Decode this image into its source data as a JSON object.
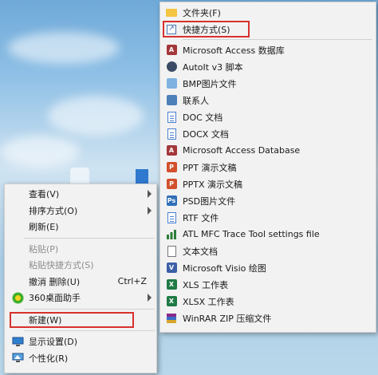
{
  "context_menu": {
    "items": [
      {
        "label": "查看(V)",
        "has_submenu": true,
        "disabled": false
      },
      {
        "label": "排序方式(O)",
        "has_submenu": true,
        "disabled": false
      },
      {
        "label": "刷新(E)",
        "has_submenu": false,
        "disabled": false
      },
      {
        "label": "粘贴(P)",
        "has_submenu": false,
        "disabled": true
      },
      {
        "label": "粘贴快捷方式(S)",
        "has_submenu": false,
        "disabled": true
      },
      {
        "label": "撤消 删除(U)",
        "shortcut": "Ctrl+Z",
        "has_submenu": false,
        "disabled": false
      },
      {
        "label": "360桌面助手",
        "icon": "360-assistant-icon",
        "has_submenu": true,
        "disabled": false
      },
      {
        "label": "新建(W)",
        "has_submenu": true,
        "disabled": false,
        "highlighted": true
      },
      {
        "label": "显示设置(D)",
        "icon": "display-settings-icon",
        "has_submenu": false,
        "disabled": false
      },
      {
        "label": "个性化(R)",
        "icon": "personalize-icon",
        "has_submenu": false,
        "disabled": false
      }
    ]
  },
  "new_submenu": {
    "items": [
      {
        "label": "文件夹(F)",
        "icon": "folder-icon"
      },
      {
        "label": "快捷方式(S)",
        "icon": "shortcut-icon",
        "highlighted": true
      },
      {
        "label": "Microsoft Access 数据库",
        "icon": "access-database-icon"
      },
      {
        "label": "AutoIt v3 脚本",
        "icon": "autoit-script-icon"
      },
      {
        "label": "BMP图片文件",
        "icon": "bmp-image-icon"
      },
      {
        "label": "联系人",
        "icon": "contact-icon"
      },
      {
        "label": "DOC 文档",
        "icon": "doc-document-icon"
      },
      {
        "label": "DOCX 文档",
        "icon": "docx-document-icon"
      },
      {
        "label": "Microsoft Access Database",
        "icon": "access-database-icon"
      },
      {
        "label": "PPT 演示文稿",
        "icon": "ppt-presentation-icon"
      },
      {
        "label": "PPTX 演示文稿",
        "icon": "pptx-presentation-icon"
      },
      {
        "label": "PSD图片文件",
        "icon": "psd-image-icon"
      },
      {
        "label": "RTF 文件",
        "icon": "rtf-file-icon"
      },
      {
        "label": "ATL MFC Trace Tool settings file",
        "icon": "atl-trace-settings-icon"
      },
      {
        "label": "文本文档",
        "icon": "text-document-icon"
      },
      {
        "label": "Microsoft Visio 绘图",
        "icon": "visio-drawing-icon"
      },
      {
        "label": "XLS 工作表",
        "icon": "xls-worksheet-icon"
      },
      {
        "label": "XLSX 工作表",
        "icon": "xlsx-worksheet-icon"
      },
      {
        "label": "WinRAR ZIP 压缩文件",
        "icon": "winrar-zip-icon"
      }
    ]
  },
  "colors": {
    "highlight_border": "#d7312d",
    "menu_background": "#f2f2f2",
    "disabled_text": "#8c8c8c"
  }
}
